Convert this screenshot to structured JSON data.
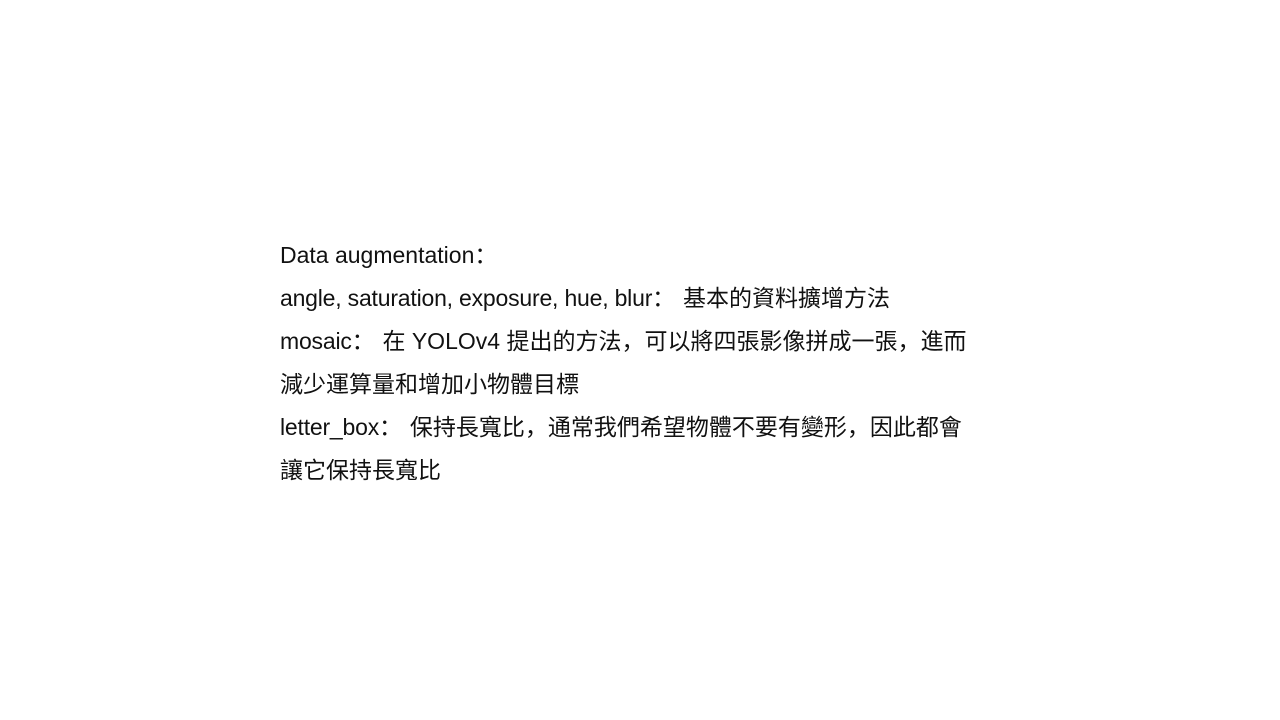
{
  "slide": {
    "heading": "Data augmentation：",
    "items": [
      {
        "term": "angle, saturation, exposure, hue, blur：",
        "description": "基本的資料擴增方法"
      },
      {
        "term": "mosaic：",
        "description": "在 YOLOv4 提出的方法，可以將四張影像拼成一張，進而",
        "continuation": "減少運算量和增加小物體目標"
      },
      {
        "term": "letter_box：",
        "description": "保持長寬比，通常我們希望物體不要有變形，因此都會",
        "continuation": "讓它保持長寬比"
      }
    ]
  }
}
